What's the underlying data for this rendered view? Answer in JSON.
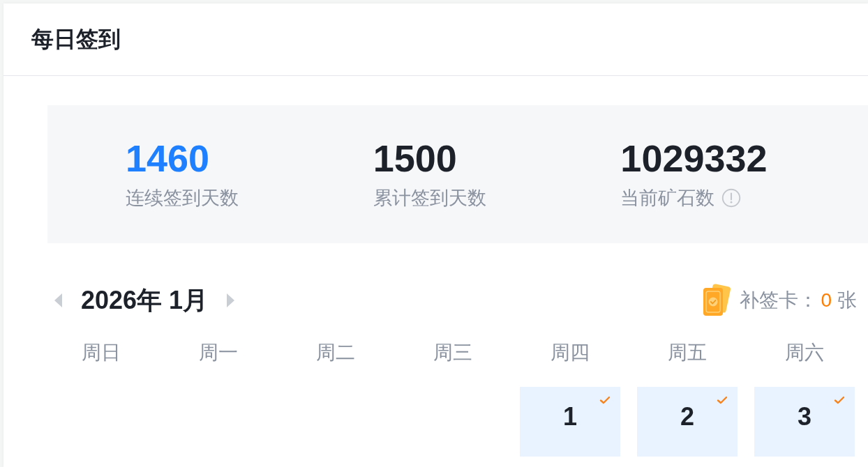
{
  "header": {
    "title": "每日签到"
  },
  "stats": [
    {
      "value": "1460",
      "label": "连续签到天数",
      "highlight": true,
      "info": false
    },
    {
      "value": "1500",
      "label": "累计签到天数",
      "highlight": false,
      "info": false
    },
    {
      "value": "1029332",
      "label": "当前矿石数",
      "highlight": false,
      "info": true
    }
  ],
  "calendar": {
    "month": "2026年 1月",
    "makeup_card": {
      "label": "补签卡：",
      "count": "0",
      "unit": "张"
    },
    "weekdays": [
      "周日",
      "周一",
      "周二",
      "周三",
      "周四",
      "周五",
      "周六"
    ],
    "weeks": [
      [
        {
          "kind": "empty"
        },
        {
          "kind": "empty"
        },
        {
          "kind": "empty"
        },
        {
          "kind": "empty"
        },
        {
          "kind": "day",
          "day": "1",
          "signed": true
        },
        {
          "kind": "day",
          "day": "2",
          "signed": true
        },
        {
          "kind": "day",
          "day": "3",
          "signed": true
        }
      ]
    ]
  }
}
